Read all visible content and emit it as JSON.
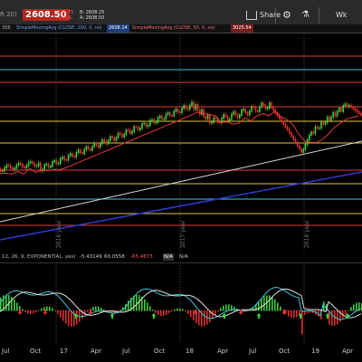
{
  "header": {
    "ticker_fragment": "R 20)",
    "last_price": "2608.50",
    "change_1": "-135.75",
    "change_2": "-4.95%",
    "bid": "B: 2608.25",
    "ask": "A: 2608.50",
    "share_label": "Share",
    "timeframe_label": "Wk"
  },
  "studies": {
    "lead_label": "308",
    "sma_200_label": "SimpleMovingAvg (CLOSE, 200, 0, no)",
    "sma_200_value": "2608.14",
    "sma_50_label": "SimpleMovingAvg (CLOSE, 50, 0, no)",
    "sma_50_value": "3025.54"
  },
  "indicator": {
    "params": "12, 26, 9, EXPONENTIAL, yes)",
    "value_1": "-5.43149",
    "value_2": "60.0558",
    "value_3": "-65.4873",
    "na_1": "N/A",
    "na_2": "N/A"
  },
  "year_labels": [
    "2016 year",
    "2017 year",
    "2018 year"
  ],
  "x_axis": {
    "ticks": [
      "Jul",
      "Oct",
      "17",
      "Apr",
      "Jul",
      "Oct",
      "18",
      "Apr",
      "Jul",
      "Oct",
      "19",
      "Apr"
    ]
  },
  "colors": {
    "background": "#000000",
    "toolbar": "#2a2a2c",
    "price_badge": "#b1261c",
    "red_line": "#e8383d",
    "yellow_line": "#e6c43a",
    "cyan_line": "#3ec7d8",
    "blue_trend": "#2f3bd0",
    "white_trend": "#d8d8d8",
    "up_candle": "#3fcf3f",
    "down_candle": "#e03030"
  }
}
